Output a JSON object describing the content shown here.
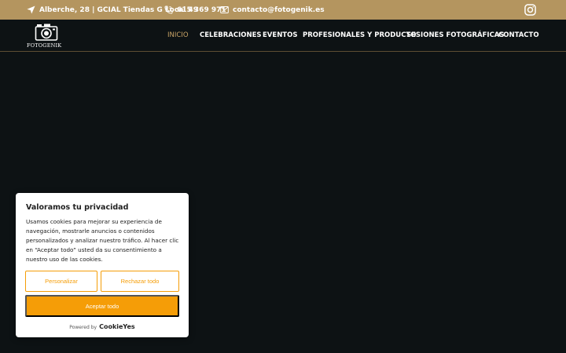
{
  "topbar": {
    "address": "Alberche, 28 | GCIAL Tiendas G Local 49",
    "phone": "615 369 971",
    "email": "contacto@fotogenik.es",
    "icons": [
      "location-arrow-icon",
      "phone-icon",
      "envelope-icon",
      "instagram-icon"
    ]
  },
  "brand": {
    "logo_text": "FOTOGENIK"
  },
  "nav": {
    "items": [
      {
        "label": "INICIO",
        "active": true
      },
      {
        "label": "CELEBRACIONES",
        "active": false
      },
      {
        "label": "EVENTOS",
        "active": false
      },
      {
        "label": "PROFESIONALES Y PRODUCTO",
        "active": false
      },
      {
        "label": "SESIONES FOTOGRÁFICAS",
        "active": false
      },
      {
        "label": "CONTACTO",
        "active": false
      }
    ]
  },
  "cookie_banner": {
    "title": "Valoramos tu privacidad",
    "body": "Usamos cookies para mejorar su experiencia de navegación, mostrarle anuncios o contenidos personalizados y analizar nuestro tráfico. Al hacer clic en “Aceptar todo” usted da su consentimiento a nuestro uso de las cookies.",
    "customize_label": "Personalizar",
    "reject_label": "Rechazar todo",
    "accept_label": "Aceptar todo",
    "powered_by": "Powered by",
    "powered_brand": "CookieYes"
  },
  "colors": {
    "topbar_bg": "#b4955f",
    "page_bg": "#0d1214",
    "nav_active": "#c9a467",
    "accent": "#f59d07"
  }
}
